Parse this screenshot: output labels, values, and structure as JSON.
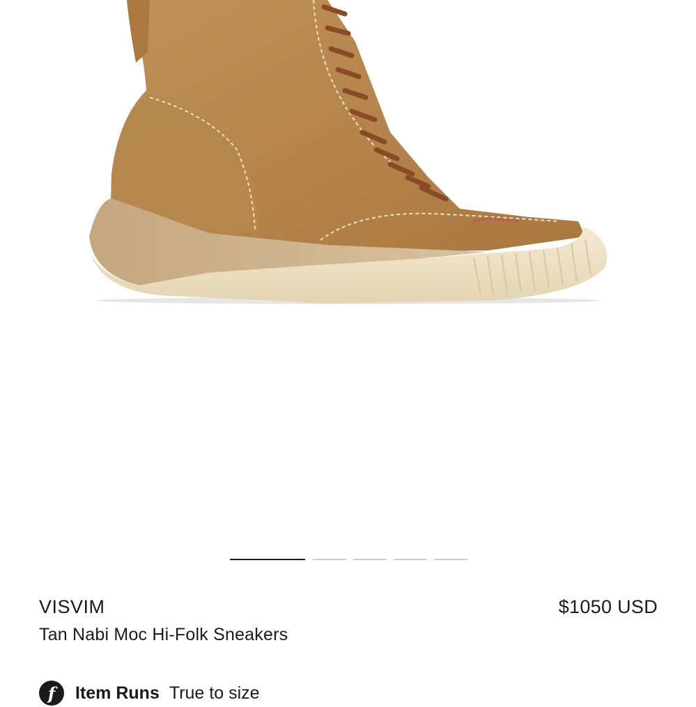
{
  "product": {
    "brand": "VISVIM",
    "name": "Tan Nabi Moc Hi-Folk Sneakers",
    "price": "$1050 USD",
    "image_icon": "boot-product-image"
  },
  "carousel": {
    "total_slides": 5,
    "active_index": 0
  },
  "fit": {
    "icon": "f-icon",
    "label": "Item Runs",
    "value": "True to size"
  },
  "colors": {
    "text": "#1a1a1a",
    "suede": "#b98a4e",
    "sole": "#ede3c9",
    "lace": "#8a4a24",
    "indicator_inactive": "#cfcfcf"
  }
}
